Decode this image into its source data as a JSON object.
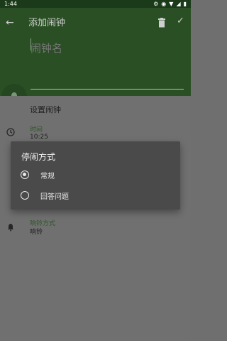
{
  "status_bar": {
    "time": "1:44",
    "icons": [
      "settings-icon",
      "gps-icon",
      "wifi-icon",
      "signal-icon",
      "battery-icon"
    ]
  },
  "header": {
    "title": "添加闹钟",
    "name_placeholder": "闹钟名",
    "icons": {
      "back": "back-arrow-icon",
      "delete": "trash-icon",
      "confirm": "check-icon",
      "alarm": "alarm-bell-icon"
    }
  },
  "settings": {
    "section_title": "设置闹钟",
    "time": {
      "label": "时间",
      "value": "10:25"
    },
    "ring": {
      "label": "响铃方式",
      "value": "响铃"
    }
  },
  "dialog": {
    "title": "停闹方式",
    "options": [
      {
        "label": "常规",
        "selected": true
      },
      {
        "label": "回答问题",
        "selected": false
      }
    ]
  },
  "colors": {
    "header": "#2a4f24",
    "accent": "#2e5728",
    "scrim": "#6f6f6f",
    "dialog": "#4a4a4a"
  }
}
